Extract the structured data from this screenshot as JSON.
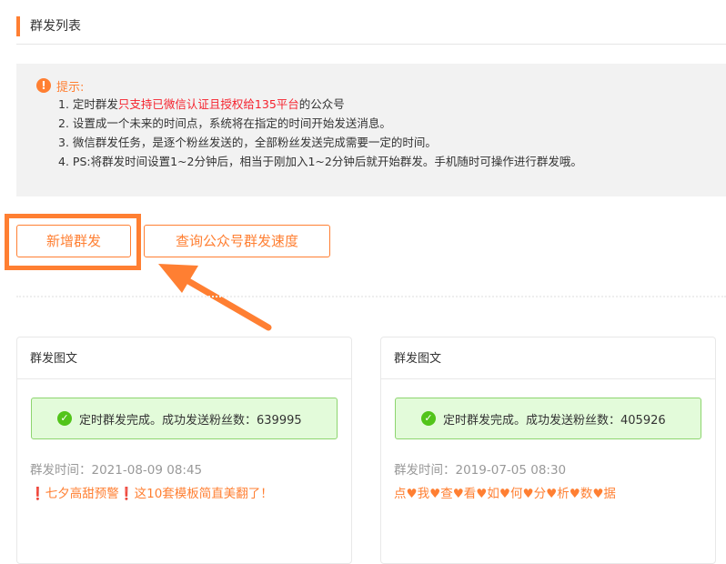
{
  "header": {
    "title": "群发列表"
  },
  "tip": {
    "title": "提示:",
    "items": [
      {
        "prefix": "1. 定时群发",
        "highlight": "只支持已微信认证且授权给135平台",
        "suffix": "的公众号"
      },
      {
        "text": "2. 设置成一个未来的时间点，系统将在指定的时间开始发送消息。"
      },
      {
        "text": "3. 微信群发任务，是逐个粉丝发送的，全部粉丝发送完成需要一定的时间。"
      },
      {
        "text": "4. PS:将群发时间设置1~2分钟后，相当于刚加入1~2分钟后就开始群发。手机随时可操作进行群发哦。"
      }
    ]
  },
  "buttons": {
    "add": "新增群发",
    "speed": "查询公众号群发速度"
  },
  "cards": [
    {
      "title": "群发图文",
      "status": "定时群发完成。成功发送粉丝数：639995",
      "time": "群发时间：2021-08-09 08:45",
      "article": "❗七夕高甜预警❗这10套模板简直美翻了！"
    },
    {
      "title": "群发图文",
      "status": "定时群发完成。成功发送粉丝数：405926",
      "time": "群发时间：2019-07-05 08:30",
      "article": "点♥我♥查♥看♥如♥何♥分♥析♥数♥据"
    }
  ],
  "colors": {
    "accent": "#ff7f32",
    "success_bg": "#e3fbda"
  }
}
